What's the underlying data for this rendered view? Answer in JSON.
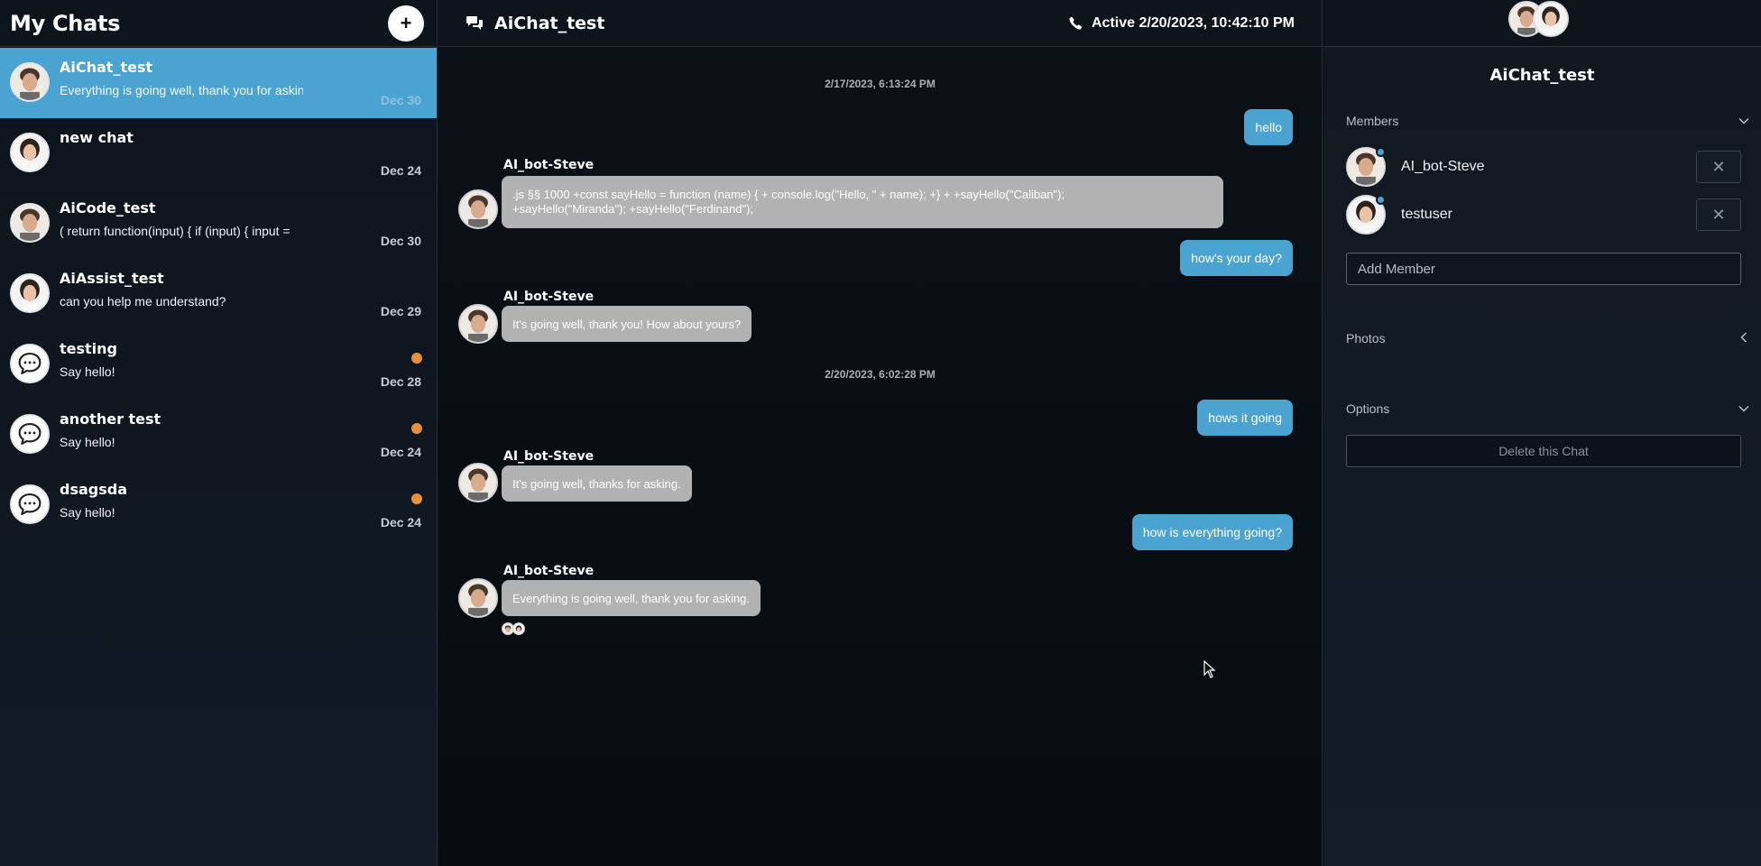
{
  "sidebar": {
    "title": "My Chats",
    "add_label": "+",
    "chats": [
      {
        "name": "AiChat_test",
        "preview": "Everything is going well, thank you for asking.",
        "date": "Dec 30",
        "avatar": "man",
        "unread": false,
        "active": true
      },
      {
        "name": "new chat",
        "preview": "",
        "date": "Dec 24",
        "avatar": "woman",
        "unread": false,
        "active": false
      },
      {
        "name": "AiCode_test",
        "preview": "( return function(input) { if (input) { input =",
        "date": "Dec 30",
        "avatar": "man",
        "unread": false,
        "active": false
      },
      {
        "name": "AiAssist_test",
        "preview": "can you help me understand?",
        "date": "Dec 29",
        "avatar": "woman",
        "unread": false,
        "active": false
      },
      {
        "name": "testing",
        "preview": "Say hello!",
        "date": "Dec 28",
        "avatar": "chat-icon",
        "unread": true,
        "active": false
      },
      {
        "name": "another test",
        "preview": "Say hello!",
        "date": "Dec 24",
        "avatar": "chat-icon",
        "unread": true,
        "active": false
      },
      {
        "name": "dsagsda",
        "preview": "Say hello!",
        "date": "Dec 24",
        "avatar": "chat-icon",
        "unread": true,
        "active": false
      }
    ]
  },
  "header": {
    "title": "AiChat_test",
    "status": "Active 2/20/2023, 10:42:10 PM"
  },
  "messages": {
    "ts1": "2/17/2023, 6:13:24 PM",
    "out1": "hello",
    "sender": "AI_bot-Steve",
    "in1_line1": ".js §§ 1000 +const sayHello = function (name) { + console.log(\"Hello, \" + name); +} + +sayHello(\"Caliban\");",
    "in1_line2": "+sayHello(\"Miranda\"); +sayHello(\"Ferdinand\");",
    "out2": "how's your day?",
    "in2": "It's going well, thank you! How about yours?",
    "ts2": "2/20/2023, 6:02:28 PM",
    "out3": "hows it going",
    "in3": "It's going well, thanks for asking.",
    "out4": "how is everything going?",
    "in4": "Everything is going well, thank you for asking."
  },
  "panel": {
    "title": "AiChat_test",
    "members_label": "Members",
    "members": [
      {
        "name": "AI_bot-Steve",
        "avatar": "man"
      },
      {
        "name": "testuser",
        "avatar": "woman"
      }
    ],
    "remove_label": "✕",
    "add_member_placeholder": "Add Member",
    "photos_label": "Photos",
    "options_label": "Options",
    "delete_label": "Delete this Chat"
  },
  "colors": {
    "accent": "#4aa3d1",
    "unread": "#e8913b",
    "incoming_bubble": "#b2b2b2"
  }
}
